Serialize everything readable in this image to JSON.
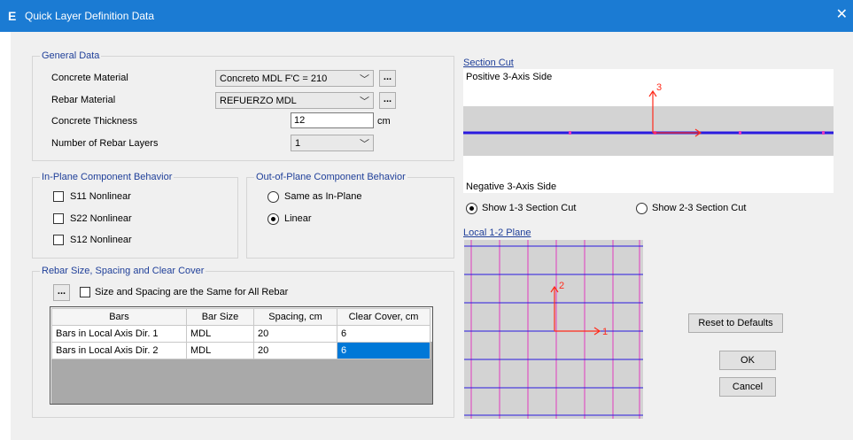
{
  "window": {
    "title": "Quick Layer Definition Data",
    "app_icon": "E"
  },
  "general": {
    "legend": "General Data",
    "concrete_material_label": "Concrete Material",
    "concrete_material_value": "Concreto MDL F'C = 210",
    "rebar_material_label": "Rebar Material",
    "rebar_material_value": "REFUERZO MDL",
    "thickness_label": "Concrete Thickness",
    "thickness_value": "12",
    "thickness_unit": "cm",
    "layers_label": "Number of Rebar Layers",
    "layers_value": "1",
    "browse": "..."
  },
  "inplane": {
    "legend": "In-Plane Component Behavior",
    "s11": "S11 Nonlinear",
    "s22": "S22 Nonlinear",
    "s12": "S12 Nonlinear"
  },
  "outplane": {
    "legend": "Out-of-Plane Component Behavior",
    "same": "Same as In-Plane",
    "linear": "Linear",
    "selected": "Linear"
  },
  "rebar": {
    "legend": "Rebar Size, Spacing and Clear Cover",
    "browse": "...",
    "same_all": "Size and Spacing are the Same for All Rebar",
    "columns": [
      "Bars",
      "Bar Size",
      "Spacing, cm",
      "Clear Cover, cm"
    ],
    "rows": [
      [
        "Bars in Local Axis Dir. 1",
        "MDL",
        "20",
        "6"
      ],
      [
        "Bars in Local Axis Dir. 2",
        "MDL",
        "20",
        "6"
      ]
    ]
  },
  "section_cut": {
    "link": "Section Cut",
    "positive": "Positive 3-Axis Side",
    "negative": "Negative 3-Axis Side",
    "axis_label": "3",
    "show13": "Show 1-3 Section Cut",
    "show23": "Show 2-3 Section Cut",
    "selected": "Show 1-3 Section Cut"
  },
  "local12": {
    "link": "Local 1-2 Plane",
    "axis1": "1",
    "axis2": "2"
  },
  "buttons": {
    "reset": "Reset to Defaults",
    "ok": "OK",
    "cancel": "Cancel"
  },
  "colors": {
    "titlebar": "#1b7bd3",
    "rebar_line": "#2a1adf",
    "grid_line": "#e03bbf",
    "axis_arrow": "#ff2a1a",
    "selection": "#0078d7",
    "legend_text": "#1f3f99"
  },
  "icons": {
    "close": "close-icon",
    "combo_arrow": "chevron-down-icon"
  }
}
